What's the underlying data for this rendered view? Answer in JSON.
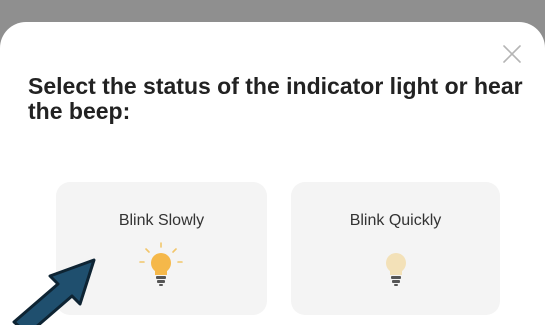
{
  "dialog": {
    "title": "Select the status of the indicator light or hear the beep:",
    "close_icon": "close-icon"
  },
  "options": [
    {
      "label": "Blink Slowly",
      "icon": "lightbulb-lit-icon",
      "state": "lit"
    },
    {
      "label": "Blink Quickly",
      "icon": "lightbulb-dim-icon",
      "state": "dim"
    }
  ],
  "annotation": {
    "icon": "pointer-arrow-icon",
    "color": "#1f4f6e"
  },
  "colors": {
    "bulb_lit": "#f5b84a",
    "bulb_dim": "#f3e1b8",
    "card_bg": "#f4f4f4",
    "header_bg": "#8f8f8f"
  }
}
